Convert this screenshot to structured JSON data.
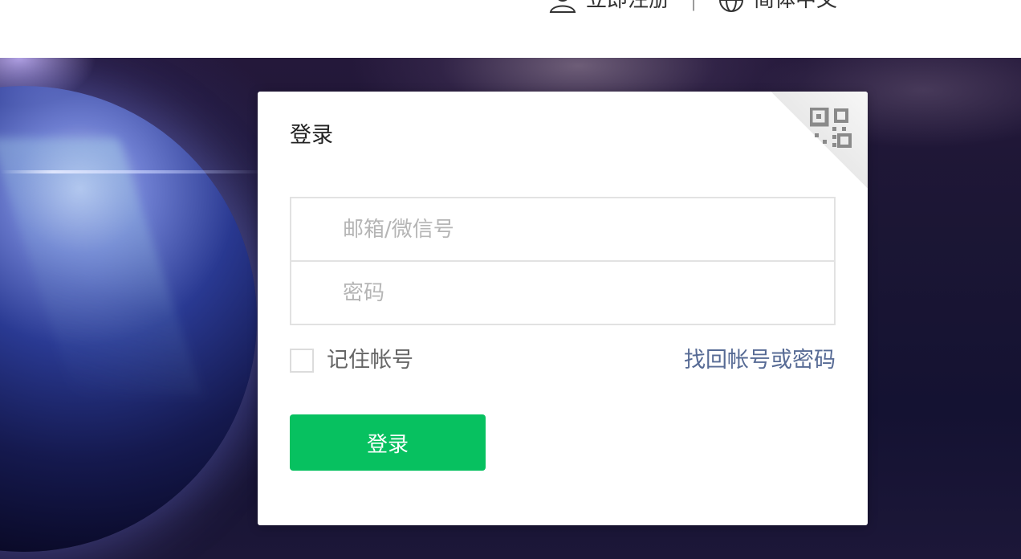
{
  "header": {
    "register_label": "立即注册",
    "separator": "|",
    "language_label": "简体中文"
  },
  "login": {
    "title": "登录",
    "account_placeholder": "邮箱/微信号",
    "password_placeholder": "密码",
    "remember_label": "记住帐号",
    "forgot_label": "找回帐号或密码",
    "submit_label": "登录",
    "qr_icon": "qr-code-icon"
  },
  "colors": {
    "primary_button": "#07c160",
    "link": "#576b95"
  }
}
